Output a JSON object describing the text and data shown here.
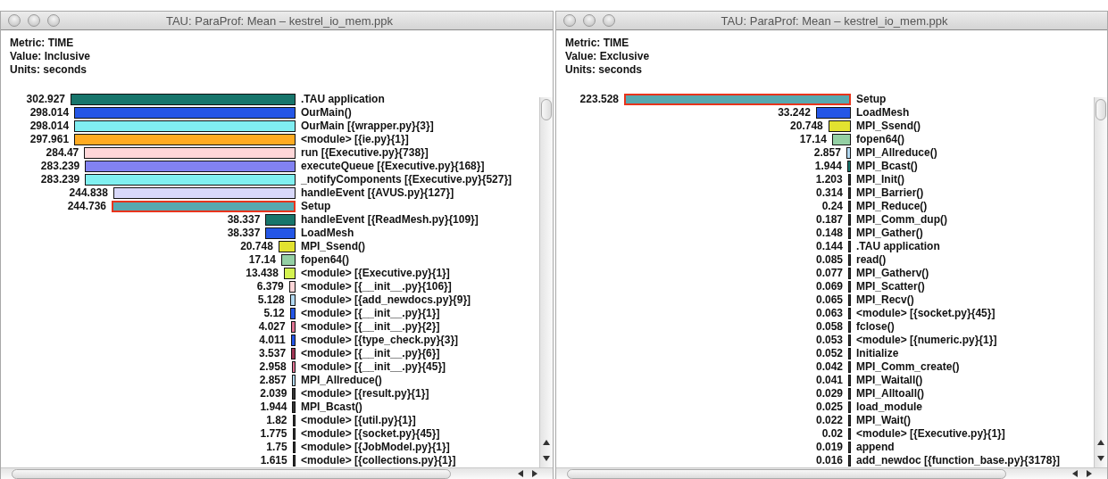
{
  "windows": [
    {
      "title": "TAU: ParaProf: Mean – kestrel_io_mem.ppk",
      "header": [
        "Metric: TIME",
        "Value: Inclusive",
        "Units: seconds"
      ],
      "rows": [
        {
          "value": "302.927",
          "name": ".TAU application",
          "color": "#17756b",
          "selected": false
        },
        {
          "value": "298.014",
          "name": "OurMain()",
          "color": "#2456e6",
          "selected": false
        },
        {
          "value": "298.014",
          "name": "OurMain [{wrapper.py}{3}]",
          "color": "#80eef2",
          "selected": false
        },
        {
          "value": "297.961",
          "name": "<module> [{ie.py}{1}]",
          "color": "#ffab22",
          "selected": false
        },
        {
          "value": "284.47",
          "name": "run [{Executive.py}{738}]",
          "color": "#ffd6d8",
          "selected": false
        },
        {
          "value": "283.239",
          "name": "executeQueue [{Executive.py}{168}]",
          "color": "#8282f2",
          "selected": false
        },
        {
          "value": "283.239",
          "name": "_notifyComponents [{Executive.py}{527}]",
          "color": "#80f0f0",
          "selected": false
        },
        {
          "value": "244.838",
          "name": "handleEvent [{AVUS.py}{127}]",
          "color": "#d8d8fa",
          "selected": false
        },
        {
          "value": "244.736",
          "name": "Setup",
          "color": "#57a9b0",
          "selected": true
        },
        {
          "value": "38.337",
          "name": "handleEvent [{ReadMesh.py}{109}]",
          "color": "#17756b",
          "selected": false
        },
        {
          "value": "38.337",
          "name": "LoadMesh",
          "color": "#2456e6",
          "selected": false
        },
        {
          "value": "20.748",
          "name": "MPI_Ssend()",
          "color": "#e2e230",
          "selected": false
        },
        {
          "value": "17.14",
          "name": "fopen64()",
          "color": "#94d0a4",
          "selected": false
        },
        {
          "value": "13.438",
          "name": "<module> [{Executive.py}{1}]",
          "color": "#d4f250",
          "selected": false
        },
        {
          "value": "6.379",
          "name": "<module> [{__init__.py}{106}]",
          "color": "#ffd6d8",
          "selected": false
        },
        {
          "value": "5.128",
          "name": "<module> [{add_newdocs.py}{9}]",
          "color": "#b4daf2",
          "selected": false
        },
        {
          "value": "5.12",
          "name": "<module> [{__init__.py}{1}]",
          "color": "#2456e6",
          "selected": false
        },
        {
          "value": "4.027",
          "name": "<module> [{__init__.py}{2}]",
          "color": "#e07494",
          "selected": false
        },
        {
          "value": "4.011",
          "name": "<module> [{type_check.py}{3}]",
          "color": "#2456e6",
          "selected": false
        },
        {
          "value": "3.537",
          "name": "<module> [{__init__.py}{6}]",
          "color": "#a03454",
          "selected": false
        },
        {
          "value": "2.958",
          "name": "<module> [{__init__.py}{45}]",
          "color": "#e07494",
          "selected": false
        },
        {
          "value": "2.857",
          "name": "MPI_Allreduce()",
          "color": "#b4daf2",
          "selected": false
        },
        {
          "value": "2.039",
          "name": "<module> [{result.py}{1}]",
          "color": "#333333",
          "selected": false
        },
        {
          "value": "1.944",
          "name": "MPI_Bcast()",
          "color": "#333333",
          "selected": false
        },
        {
          "value": "1.82",
          "name": "<module> [{util.py}{1}]",
          "color": "#333333",
          "selected": false
        },
        {
          "value": "1.775",
          "name": "<module> [{socket.py}{45}]",
          "color": "#333333",
          "selected": false
        },
        {
          "value": "1.75",
          "name": "<module> [{JobModel.py}{1}]",
          "color": "#333333",
          "selected": false
        },
        {
          "value": "1.615",
          "name": "<module> [{collections.py}{1}]",
          "color": "#333333",
          "selected": false
        }
      ]
    },
    {
      "title": "TAU: ParaProf: Mean – kestrel_io_mem.ppk",
      "header": [
        "Metric: TIME",
        "Value: Exclusive",
        "Units: seconds"
      ],
      "rows": [
        {
          "value": "223.528",
          "name": "Setup",
          "color": "#57a9b0",
          "selected": true
        },
        {
          "value": "33.242",
          "name": "LoadMesh",
          "color": "#2456e6",
          "selected": false
        },
        {
          "value": "20.748",
          "name": "MPI_Ssend()",
          "color": "#e2e230",
          "selected": false
        },
        {
          "value": "17.14",
          "name": "fopen64()",
          "color": "#94d0a4",
          "selected": false
        },
        {
          "value": "2.857",
          "name": "MPI_Allreduce()",
          "color": "#b4daf2",
          "selected": false
        },
        {
          "value": "1.944",
          "name": "MPI_Bcast()",
          "color": "#17756b",
          "selected": false
        },
        {
          "value": "1.203",
          "name": "MPI_Init()",
          "color": "#333333",
          "selected": false
        },
        {
          "value": "0.314",
          "name": "MPI_Barrier()",
          "color": "#333333",
          "selected": false
        },
        {
          "value": "0.24",
          "name": "MPI_Reduce()",
          "color": "#333333",
          "selected": false
        },
        {
          "value": "0.187",
          "name": "MPI_Comm_dup()",
          "color": "#333333",
          "selected": false
        },
        {
          "value": "0.148",
          "name": "MPI_Gather()",
          "color": "#333333",
          "selected": false
        },
        {
          "value": "0.144",
          "name": ".TAU application",
          "color": "#333333",
          "selected": false
        },
        {
          "value": "0.085",
          "name": "read()",
          "color": "#333333",
          "selected": false
        },
        {
          "value": "0.077",
          "name": "MPI_Gatherv()",
          "color": "#333333",
          "selected": false
        },
        {
          "value": "0.069",
          "name": "MPI_Scatter()",
          "color": "#333333",
          "selected": false
        },
        {
          "value": "0.065",
          "name": "MPI_Recv()",
          "color": "#333333",
          "selected": false
        },
        {
          "value": "0.063",
          "name": "<module> [{socket.py}{45}]",
          "color": "#333333",
          "selected": false
        },
        {
          "value": "0.058",
          "name": "fclose()",
          "color": "#333333",
          "selected": false
        },
        {
          "value": "0.053",
          "name": "<module> [{numeric.py}{1}]",
          "color": "#333333",
          "selected": false
        },
        {
          "value": "0.052",
          "name": "Initialize",
          "color": "#333333",
          "selected": false
        },
        {
          "value": "0.042",
          "name": "MPI_Comm_create()",
          "color": "#333333",
          "selected": false
        },
        {
          "value": "0.041",
          "name": "MPI_Waitall()",
          "color": "#333333",
          "selected": false
        },
        {
          "value": "0.029",
          "name": "MPI_Alltoall()",
          "color": "#333333",
          "selected": false
        },
        {
          "value": "0.025",
          "name": "load_module",
          "color": "#333333",
          "selected": false
        },
        {
          "value": "0.022",
          "name": "MPI_Wait()",
          "color": "#333333",
          "selected": false
        },
        {
          "value": "0.02",
          "name": "<module> [{Executive.py}{1}]",
          "color": "#333333",
          "selected": false
        },
        {
          "value": "0.019",
          "name": "append",
          "color": "#333333",
          "selected": false
        },
        {
          "value": "0.016",
          "name": "add_newdoc [{function_base.py}{3178}]",
          "color": "#333333",
          "selected": false
        }
      ]
    }
  ]
}
